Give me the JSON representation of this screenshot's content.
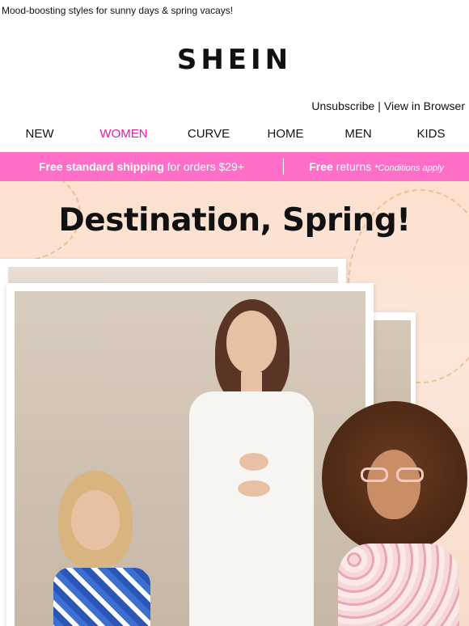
{
  "preheader": "Mood-boosting styles for sunny days & spring vacays!",
  "brand": {
    "logo_text": "SHEIN"
  },
  "utility": {
    "unsubscribe": "Unsubscribe",
    "separator": "|",
    "view_in_browser": "View in Browser"
  },
  "nav": {
    "items": [
      {
        "label": "NEW"
      },
      {
        "label": "WOMEN",
        "active": true
      },
      {
        "label": "CURVE"
      },
      {
        "label": "HOME"
      },
      {
        "label": "MEN"
      },
      {
        "label": "KIDS"
      }
    ]
  },
  "shipping_bar": {
    "left_bold": "Free standard shipping",
    "left_rest": " for orders $29+",
    "right_bold": "Free",
    "right_rest": " returns ",
    "right_note": "*Conditions apply"
  },
  "hero": {
    "title": "Destination, Spring!",
    "image_alt": "Three models wearing spring dresses in white photo frames"
  },
  "colors": {
    "accent_pink": "#ff6fc7",
    "active_nav": "#e51aa5",
    "hero_bg": "#fde0cf"
  }
}
